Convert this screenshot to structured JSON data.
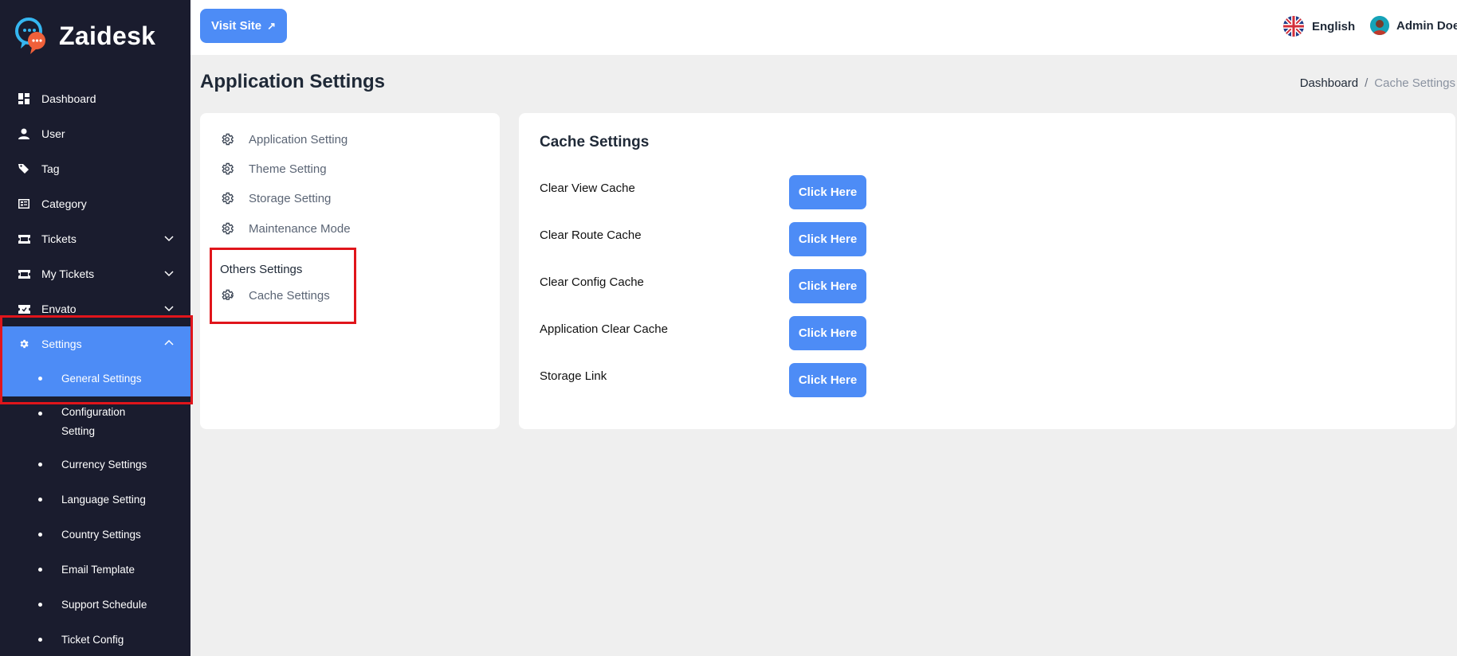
{
  "brand": {
    "name": "Zaidesk"
  },
  "sidebar": {
    "items": [
      {
        "label": "Dashboard",
        "icon": "dashboard-icon"
      },
      {
        "label": "User",
        "icon": "user-icon"
      },
      {
        "label": "Tag",
        "icon": "tag-icon"
      },
      {
        "label": "Category",
        "icon": "category-icon"
      },
      {
        "label": "Tickets",
        "icon": "ticket-icon",
        "expandable": true
      },
      {
        "label": "My Tickets",
        "icon": "ticket-icon",
        "expandable": true
      },
      {
        "label": "Envato",
        "icon": "envato-icon",
        "expandable": true
      },
      {
        "label": "Settings",
        "icon": "gear-icon",
        "expandable": true,
        "expanded": true,
        "active": true
      }
    ],
    "sub_items": [
      {
        "label": "General Settings",
        "active": true
      },
      {
        "label": "Configuration Setting"
      },
      {
        "label": "Currency Settings"
      },
      {
        "label": "Language Setting"
      },
      {
        "label": "Country Settings"
      },
      {
        "label": "Email Template"
      },
      {
        "label": "Support Schedule"
      },
      {
        "label": "Ticket Config"
      }
    ]
  },
  "topbar": {
    "visit_site": "Visit Site",
    "language": "English",
    "user_name": "Admin Doe"
  },
  "page": {
    "title": "Application Settings",
    "breadcrumb": {
      "home": "Dashboard",
      "separator": "/",
      "current": "Cache Settings"
    }
  },
  "settings_menu": {
    "items": [
      "Application Setting",
      "Theme Setting",
      "Storage Setting",
      "Maintenance Mode"
    ],
    "others_title": "Others Settings",
    "others_items": [
      "Cache Settings"
    ]
  },
  "cache": {
    "title": "Cache Settings",
    "rows": [
      {
        "label": "Clear View Cache",
        "button": "Click Here"
      },
      {
        "label": "Clear Route Cache",
        "button": "Click Here"
      },
      {
        "label": "Clear Config Cache",
        "button": "Click Here"
      },
      {
        "label": "Application Clear Cache",
        "button": "Click Here"
      },
      {
        "label": "Storage Link",
        "button": "Click Here"
      }
    ]
  },
  "colors": {
    "sidebar_bg": "#1a1c2e",
    "accent": "#4d8cf6",
    "highlight_box": "#e0151b",
    "page_bg": "#efefef"
  }
}
